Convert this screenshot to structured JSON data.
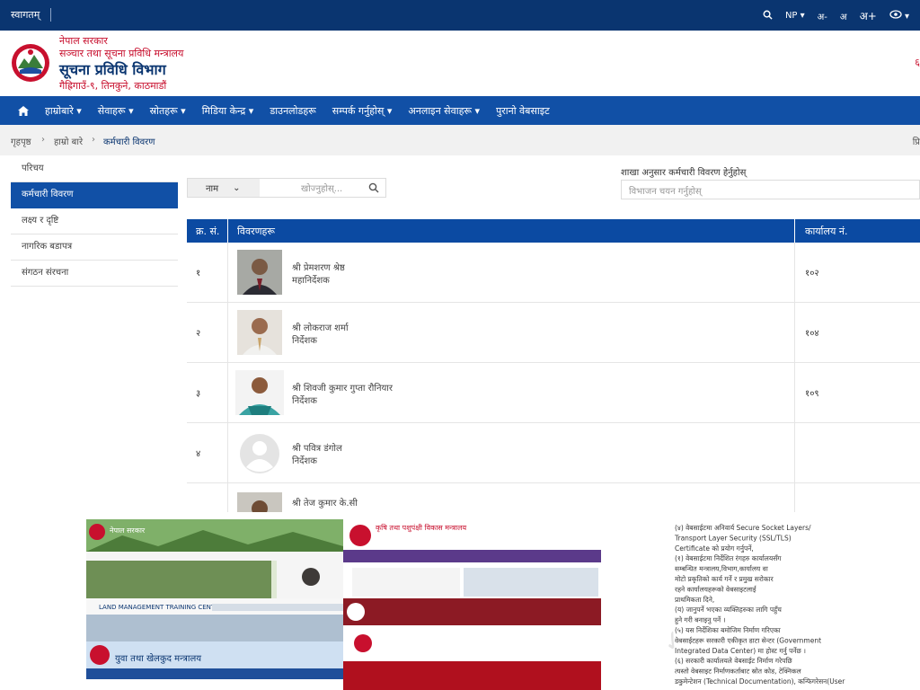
{
  "topbar": {
    "welcome": "स्वागतम्",
    "language": "NP",
    "font_sizes": [
      "अ-",
      "अ",
      "अ+"
    ]
  },
  "header": {
    "gov": "नेपाल सरकार",
    "ministry": "सञ्चार तथा सूचना प्रविधि मन्त्रालय",
    "department": "सूचना प्रविधि विभाग",
    "address": "गैह्रिगाउँ-९, तिनकुने, काठमाडौं",
    "edge_text": "६"
  },
  "nav": {
    "items": [
      "हाम्रोबारे",
      "सेवाहरू",
      "स्रोतहरू",
      "मिडिया केन्द्र",
      "डाउनलोडहरू",
      "सम्पर्क गर्नुहोस्",
      "अनलाइन सेवाहरू",
      "पुरानो वेबसाइट"
    ]
  },
  "breadcrumb": {
    "home": "गृहपृष्ठ",
    "about": "हाम्रो बारे",
    "current": "कर्मचारी विवरण",
    "edge": "प्रि"
  },
  "sidebar": {
    "items": [
      "परिचय",
      "कर्मचारी विवरण",
      "लक्ष्य र दृष्टि",
      "नागरिक बडापत्र",
      "संगठन संरचना"
    ]
  },
  "search": {
    "select": "नाम",
    "placeholder": "खोज्नुहोस्..."
  },
  "branch": {
    "label": "शाखा अनुसार कर्मचारी विवरण हेर्नुहोस्",
    "placeholder": "विभाजन चयन गर्नुहोस्"
  },
  "table": {
    "headers": {
      "sn": "क्र. सं.",
      "details": "विवरणहरू",
      "office": "कार्यालय नं."
    },
    "rows": [
      {
        "sn": "१",
        "name": "श्री प्रेमशरण श्रेष्ठ",
        "role": "महानिर्देशक",
        "office": "१०२"
      },
      {
        "sn": "२",
        "name": "श्री लोकराज शर्मा",
        "role": "निर्देशक",
        "office": "१०४"
      },
      {
        "sn": "३",
        "name": "श्री शिवजी कुमार गुप्ता रौनियार",
        "role": "निर्देशक",
        "office": "१०९"
      },
      {
        "sn": "४",
        "name": "श्री पवित्र डंगोल",
        "role": "निर्देशक",
        "office": ""
      },
      {
        "sn": "",
        "name": "श्री तेज कुमार के.सी",
        "role": "",
        "office": ""
      }
    ]
  },
  "collage": {
    "site1_title": "नेपाल सरकार",
    "site2_title": "कृषि तथा पशुपंक्षी विकास मन्त्रालय",
    "site3_title": "LAND MANAGEMENT TRAINING CENTER",
    "site4_title": "युवा तथा खेलकुद मन्त्रालय",
    "doc_lines": [
      "(४) वेबसाईटमा अनिवार्य Secure Socket Layers/",
      "Transport Layer Security (SSL/TLS)",
      "Certificate को प्रयोग गर्नुपर्ने,",
      "(१) वेबसाईटमा निर्देशित रंगहरु कार्यालयसँग",
      "सम्बन्धित मन्त्रालय,विभाग,कार्यालय वा",
      "मोटो प्रकृतिको कार्य गर्ने र प्रमुख सरोकार",
      "रहने कार्यालयहरूको वेबसाइटलाई",
      "प्राथमिकता दिने,",
      "(य) जानुपर्ने भएका व्यक्तिहरुका लागि पहुँच",
      "हुने गरी बनाइनु पर्ने ।",
      "(५) यस निर्देशिका बमोजिम निर्माण गरिएका",
      "वेबसाईटहरू सरकारी एकीकृत डाटा सेन्टर (Government",
      "Integrated Data Center) मा होस्ट गर्नु पर्नेछ ।",
      "(६) सरकारी कार्यालयले वेबसाईट निर्माण गरेपछि",
      "त्यस्तो वेबसाइट निर्माणकर्ताबाट स्रोत कोड, टेक्निकल",
      "डकुमेन्टेशन (Technical Documentation), कन्फिगरेसन(User"
    ]
  },
  "colors": {
    "topbar": "#0a3570",
    "nav": "#1150a6",
    "accent_red": "#c8102e",
    "table_head": "#0b4aa2"
  },
  "icons": [
    "home-icon",
    "search-icon",
    "eye-icon",
    "chevron-down-icon",
    "emblem-logo"
  ]
}
